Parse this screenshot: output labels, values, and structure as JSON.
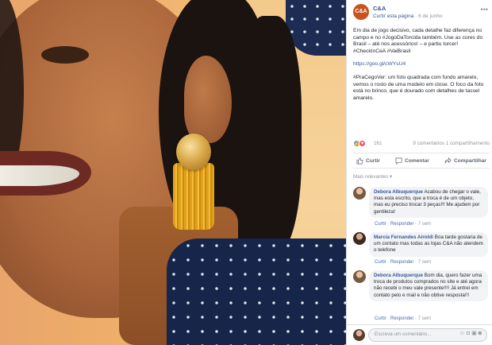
{
  "page": {
    "name": "C&A",
    "avatar_text": "C&A",
    "follow_label": "Curtir esta página",
    "date": "6 de junho",
    "more_icon": "more-options-icon"
  },
  "post": {
    "paragraphs": [
      "Em dia de jogo decisivo, cada detalhe faz diferença no campo e no #JogoDaTorcida também. Use as cores do Brasil – até nos acessórios! – e partiu torcer! #CheckInCeA #VaiBrasil",
      "https://goo.gl/cWYsU4",
      "#PraCegoVer: um foto quadrada com fundo amarelo, vemos o rosto de uma modelo em close. O foco da foto está no brinco, que é dourado com detalhes de tassel amarelo."
    ]
  },
  "reactions": {
    "count": "161",
    "comments": "9 comentários",
    "shares": "1 compartilhamento"
  },
  "actions": {
    "like": "Curtir",
    "comment": "Comentar",
    "share": "Compartilhar"
  },
  "relevance_label": "Mais relevantes ▾",
  "comments": [
    {
      "name": "Debora Albuquerque",
      "text": "Acabou de chegar o vale, mas esta escrito, que a troca é de um objeto, mas eu preciso trocar 3 peças!!! Me ajudem por gentileza!",
      "like_label": "Curtir",
      "reply_label": "Responder",
      "time": "7 sem"
    },
    {
      "name": "Marcia Fernandes Airoldi",
      "text": "Boa tarde gostaria de um contato mas todas as lojas C&A não atendem o telefone",
      "like_label": "Curtir",
      "reply_label": "Responder",
      "time": "7 sem"
    },
    {
      "name": "Debora Albuquerque",
      "text": "Bom dia, quero fazer uma troca de produtos comprados no site e até agora não recebi o meu vale presente!!!! Já entrei em contato pelo e mail e não obtive resposta!!!",
      "like_label": "Curtir",
      "reply_label": "Responder",
      "time": "7 sem"
    }
  ],
  "comment_input": {
    "placeholder": "Escreva um comentário..."
  },
  "colors": {
    "link": "#365899",
    "brand": "#c8531e",
    "background_photo": "#f3c07a"
  }
}
